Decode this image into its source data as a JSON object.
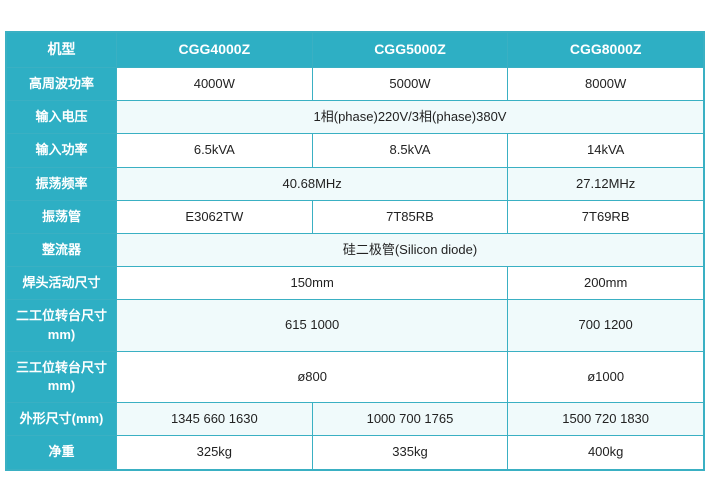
{
  "table": {
    "headers": [
      "机型",
      "CGG4000Z",
      "CGG5000Z",
      "CGG8000Z"
    ],
    "rows": [
      {
        "label": "高周波功率",
        "cells": [
          "4000W",
          "5000W",
          "8000W"
        ],
        "colspan": null
      },
      {
        "label": "输入电压",
        "cells": [
          "1相(phase)220V/3相(phase)380V"
        ],
        "colspan": 3
      },
      {
        "label": "输入功率",
        "cells": [
          "6.5kVA",
          "8.5kVA",
          "14kVA"
        ],
        "colspan": null
      },
      {
        "label": "振荡频率",
        "cells": [
          "40.68MHz",
          "27.12MHz"
        ],
        "colspan_map": {
          "0": 2,
          "1": 1
        }
      },
      {
        "label": "振荡管",
        "cells": [
          "E3062TW",
          "7T85RB",
          "7T69RB"
        ],
        "colspan": null
      },
      {
        "label": "整流器",
        "cells": [
          "硅二极管(Silicon diode)"
        ],
        "colspan": 3
      },
      {
        "label": "焊头活动尺寸",
        "cells": [
          "150mm",
          "200mm"
        ],
        "colspan_map": {
          "0": 2,
          "1": 1
        }
      },
      {
        "label": "二工位转台尺寸mm)",
        "cells": [
          "615 1000",
          "700 1200"
        ],
        "colspan_map": {
          "0": 2,
          "1": 1
        }
      },
      {
        "label": "三工位转台尺寸mm)",
        "cells": [
          "ø800",
          "ø1000"
        ],
        "colspan_map": {
          "0": 2,
          "1": 1
        }
      },
      {
        "label": "外形尺寸(mm)",
        "cells": [
          "1345 660 1630",
          "1000 700 1765",
          "1500 720 1830"
        ],
        "colspan": null
      },
      {
        "label": "净重",
        "cells": [
          "325kg",
          "335kg",
          "400kg"
        ],
        "colspan": null
      }
    ]
  }
}
